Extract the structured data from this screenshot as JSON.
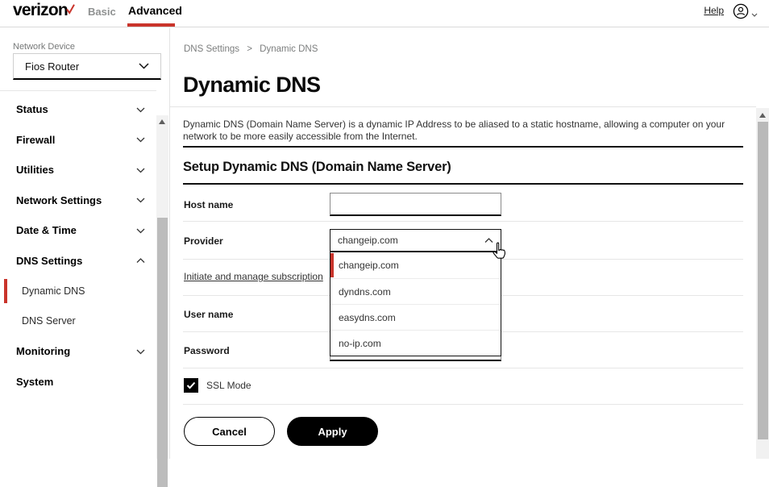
{
  "header": {
    "logo_text": "verizon",
    "nav_basic": "Basic",
    "nav_advanced": "Advanced",
    "help_label": "Help"
  },
  "sidebar": {
    "device_label": "Network Device",
    "device_value": "Fios Router",
    "items": [
      {
        "label": "Status",
        "state": "collapsed"
      },
      {
        "label": "Firewall",
        "state": "collapsed"
      },
      {
        "label": "Utilities",
        "state": "collapsed"
      },
      {
        "label": "Network Settings",
        "state": "collapsed"
      },
      {
        "label": "Date & Time",
        "state": "collapsed"
      },
      {
        "label": "DNS Settings",
        "state": "expanded"
      },
      {
        "label": "Monitoring",
        "state": "collapsed"
      },
      {
        "label": "System",
        "state": "none"
      }
    ],
    "dns_children": [
      {
        "label": "Dynamic DNS",
        "active": true
      },
      {
        "label": "DNS Server",
        "active": false
      }
    ]
  },
  "breadcrumb": {
    "items": [
      "DNS Settings",
      "Dynamic DNS"
    ],
    "separator": ">"
  },
  "page": {
    "title": "Dynamic DNS",
    "description": "Dynamic DNS (Domain Name Server) is a dynamic IP Address to be aliased to a static hostname, allowing a computer on your network to be more easily accessible from the Internet.",
    "section_heading": "Setup Dynamic DNS (Domain Name Server)"
  },
  "form": {
    "host_name": {
      "label": "Host name",
      "value": ""
    },
    "provider": {
      "label": "Provider",
      "selected": "changeip.com",
      "open": true,
      "options": [
        "changeip.com",
        "dyndns.com",
        "easydns.com",
        "no-ip.com"
      ]
    },
    "subscription_link": "Initiate and manage subscription",
    "user_name": {
      "label": "User name",
      "value": ""
    },
    "password": {
      "label": "Password",
      "value": ""
    },
    "ssl_mode": {
      "label": "SSL Mode",
      "checked": true
    },
    "buttons": {
      "cancel": "Cancel",
      "apply": "Apply"
    }
  },
  "colors": {
    "brand_red": "#c9342b",
    "text_gray": "#767878",
    "separator": "#e6e6e6",
    "black": "#000000"
  }
}
